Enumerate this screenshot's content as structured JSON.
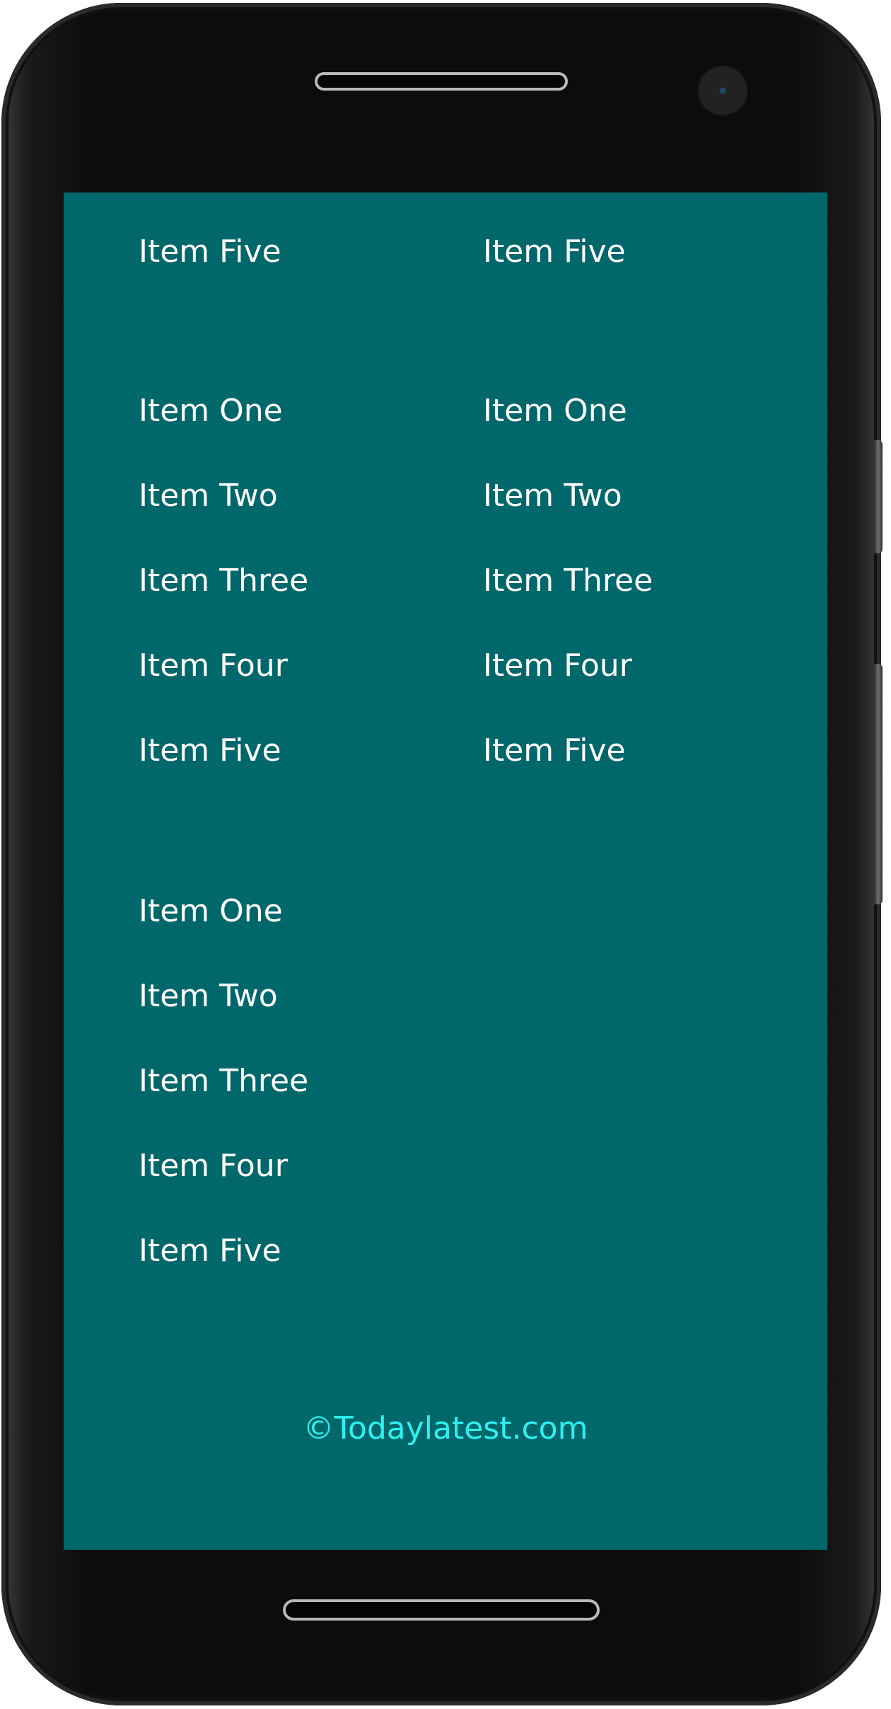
{
  "screen": {
    "background_color": "#00676a",
    "text_color": "#ffffff",
    "accent_color": "#2ff0f0"
  },
  "list_top": {
    "left": [
      "Item Five"
    ],
    "right": [
      "Item Five"
    ]
  },
  "list_middle": {
    "left": [
      "Item One",
      "Item Two",
      "Item Three",
      "Item Four",
      "Item Five"
    ],
    "right": [
      "Item One",
      "Item Two",
      "Item Three",
      "Item Four",
      "Item Five"
    ]
  },
  "list_bottom": {
    "left": [
      "Item One",
      "Item Two",
      "Item Three",
      "Item Four",
      "Item Five"
    ]
  },
  "footer": {
    "text": "©Todaylatest.com"
  },
  "device": {
    "speaker_icon": "speaker-grille-icon",
    "camera_icon": "front-camera-icon",
    "home_icon": "home-bar-icon"
  }
}
